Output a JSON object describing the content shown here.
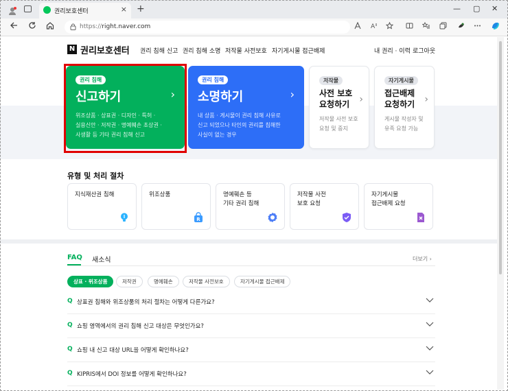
{
  "browser": {
    "tab_title": "권리보호센터",
    "tab_close": "×",
    "new_tab": "+",
    "url_prefix": "https://",
    "url_domain": "right.naver.com",
    "minimize": "—",
    "restore": "▢",
    "close": "✕",
    "icons": [
      "profile-icon",
      "tab-actions-icon",
      "back-icon",
      "refresh-icon",
      "home-icon",
      "lock-icon",
      "read-aloud-icon",
      "favorite-icon",
      "split-screen-icon",
      "favorites-icon",
      "collections-icon",
      "extensions-icon",
      "copilot-icon"
    ]
  },
  "header": {
    "logo_mark": "N",
    "title": "권리보호센터",
    "nav": [
      "권리 침해 신고",
      "권리 침해 소명",
      "저작물 사전보호",
      "자기게시물 접근배제"
    ],
    "my_rights": "내 권리 · 이력",
    "logout": "로그아웃"
  },
  "cards": {
    "report": {
      "badge": "권리 침해",
      "title": "신고하기",
      "desc_lines": [
        "위조상품 · 상표권 · 디자인 · 특허 ·",
        "실용신안 · 저작권 · 명예훼손 초상권 ·",
        "사생활 등 기타 권리 침해 신고"
      ]
    },
    "explain": {
      "badge": "권리 침해",
      "title": "소명하기",
      "desc_lines": [
        "내 상품 · 게시물이 권리 침해 사유로",
        "신고 되었으나 타인의 권리를 침해한",
        "사실이 없는 경우"
      ]
    },
    "preprotect": {
      "badge": "저작물",
      "title_lines": [
        "사전 보호",
        "요청하기"
      ],
      "desc_lines": [
        "저작물 사전 보호",
        "요청 및 중지"
      ]
    },
    "exclude": {
      "badge": "자기게시물",
      "title_lines": [
        "접근배제",
        "요청하기"
      ],
      "desc_lines": [
        "게시물 작성자 및",
        "유족 요청 가능"
      ]
    },
    "arrow": "›"
  },
  "types": {
    "title": "유형 및 처리 절차",
    "items": [
      {
        "label_lines": [
          "지식재산권 침해"
        ],
        "icon": "lightbulb-icon",
        "color": "#2bb3ff"
      },
      {
        "label_lines": [
          "위조상품"
        ],
        "icon": "shopping-bag-icon",
        "color": "#3a9bff"
      },
      {
        "label_lines": [
          "명예훼손 등",
          "기타 권리 침해"
        ],
        "icon": "badge-icon",
        "color": "#4d7ef7"
      },
      {
        "label_lines": [
          "저작물 사전",
          "보호 요청"
        ],
        "icon": "shield-check-icon",
        "color": "#7b5cf5"
      },
      {
        "label_lines": [
          "자기게시물",
          "접근배제 요청"
        ],
        "icon": "document-x-icon",
        "color": "#9b59d0"
      }
    ]
  },
  "faq": {
    "tab_faq": "FAQ",
    "tab_news": "새소식",
    "more": "더보기",
    "chips": [
      "상표 · 위조상품",
      "저작권",
      "명예훼손",
      "저작물 사전보호",
      "자기게시물 접근배제"
    ],
    "q_mark": "Q",
    "items": [
      "상표권 침해와 위조상품의 처리 절차는 어떻게 다른가요?",
      "쇼핑 영역에서의 권리 침해 신고 대상은 무엇인가요?",
      "쇼핑 내 신고 대상 URL을 어떻게 확인하나요?",
      "KIPRIS에서 DOI 정보를 어떻게 확인하나요?"
    ]
  },
  "colors": {
    "green": "#03b05c",
    "blue": "#2d6ef7",
    "highlight": "#e00000"
  }
}
